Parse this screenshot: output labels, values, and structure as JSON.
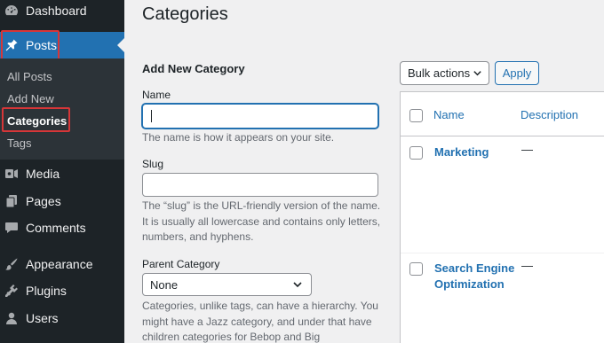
{
  "sidebar": {
    "items": [
      {
        "label": "Dashboard",
        "icon": "dashboard-icon"
      },
      {
        "label": "Posts",
        "icon": "pin-icon",
        "active": true
      },
      {
        "label": "Media",
        "icon": "media-icon"
      },
      {
        "label": "Pages",
        "icon": "pages-icon"
      },
      {
        "label": "Comments",
        "icon": "comment-icon"
      },
      {
        "label": "Appearance",
        "icon": "brush-icon"
      },
      {
        "label": "Plugins",
        "icon": "plugin-icon"
      },
      {
        "label": "Users",
        "icon": "user-icon"
      }
    ],
    "submenu": [
      {
        "label": "All Posts"
      },
      {
        "label": "Add New"
      },
      {
        "label": "Categories",
        "current": true
      },
      {
        "label": "Tags"
      }
    ],
    "active_color": "#2271b1",
    "highlight_color": "#d63638"
  },
  "page": {
    "title": "Categories"
  },
  "form": {
    "title": "Add New Category",
    "name_label": "Name",
    "name_value": "",
    "name_help": "The name is how it appears on your site.",
    "slug_label": "Slug",
    "slug_value": "",
    "slug_help": "The “slug” is the URL-friendly version of the name. It is usually all lowercase and contains only letters, numbers, and hyphens.",
    "parent_label": "Parent Category",
    "parent_value": "None",
    "parent_help": "Categories, unlike tags, can have a hierarchy. You might have a Jazz category, and under that have children categories for Bebop and Big"
  },
  "table": {
    "bulk_actions": "Bulk actions",
    "apply": "Apply",
    "columns": [
      "Name",
      "Description"
    ],
    "rows": [
      {
        "name": "Marketing",
        "description": "—"
      },
      {
        "name": "Search Engine Optimization",
        "description": "—"
      }
    ]
  }
}
